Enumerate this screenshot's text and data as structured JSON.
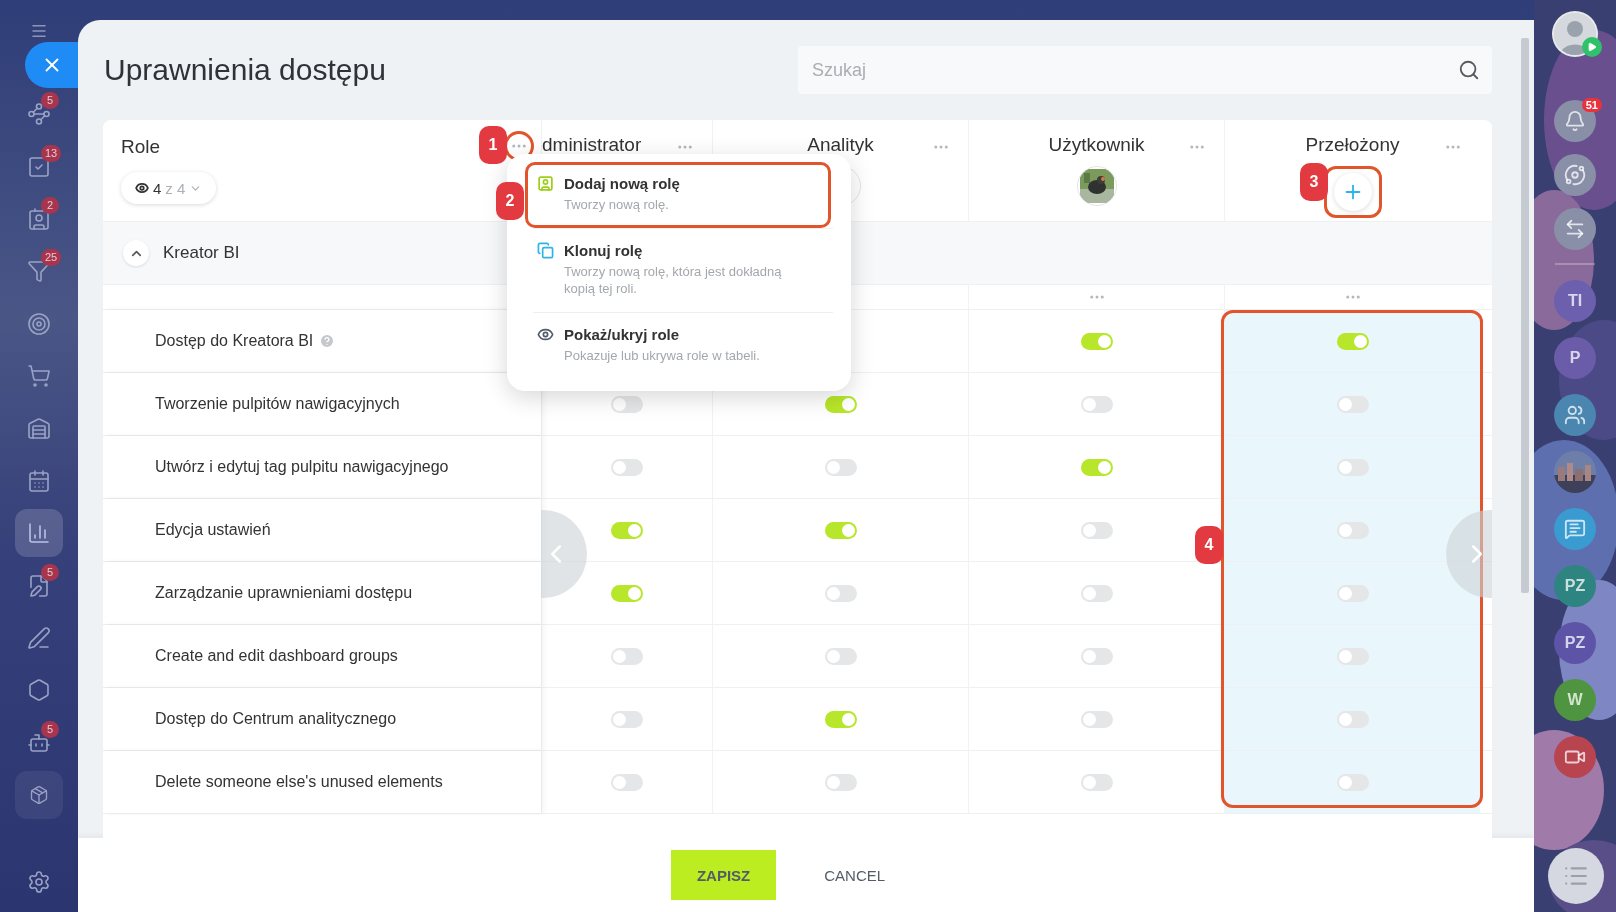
{
  "nav": {
    "items": [
      {
        "badge": "5",
        "selected": false
      },
      {
        "badge": "13",
        "selected": false
      },
      {
        "badge": "2",
        "selected": false
      },
      {
        "badge": "25",
        "selected": false
      },
      {
        "selected": false
      },
      {
        "selected": false
      },
      {
        "selected": false
      },
      {
        "selected": false
      },
      {
        "selected": true
      },
      {
        "badge": "5",
        "selected": false
      },
      {
        "selected": false
      },
      {
        "selected": false
      },
      {
        "badge": "5",
        "selected": false
      }
    ]
  },
  "dialog": {
    "title": "Uprawnienia dostępu",
    "search": {
      "placeholder": "Szukaj"
    }
  },
  "table": {
    "roles_header": {
      "label": "Role",
      "shown": "4",
      "total": "z 4"
    },
    "columns": [
      {
        "title": "dministrator",
        "kind": "plain"
      },
      {
        "title": "Analityk",
        "kind": "blank"
      },
      {
        "title": "Użytkownik"
      },
      {
        "title": "Przełożony",
        "kind": "add",
        "highlighted": true
      }
    ],
    "group": {
      "label": "Kreator BI",
      "expanded": true
    },
    "rows": [
      {
        "label": "Dostęp do Kreatora BI",
        "help": true,
        "cells": [
          {},
          {},
          {
            "on": true
          },
          {
            "on": true
          }
        ]
      },
      {
        "label": "Tworzenie pulpitów nawigacyjnych",
        "help": false,
        "cells": [
          {
            "on": false
          },
          {
            "on": true
          },
          {
            "on": false
          },
          {
            "on": false
          }
        ]
      },
      {
        "label": "Utwórz i edytuj tag pulpitu nawigacyjnego",
        "help": false,
        "cells": [
          {
            "on": false
          },
          {
            "on": false
          },
          {
            "on": true
          },
          {
            "on": false
          }
        ]
      },
      {
        "label": "Edycja ustawień",
        "help": false,
        "cells": [
          {
            "on": true
          },
          {
            "on": true
          },
          {
            "on": false
          },
          {
            "on": false
          }
        ]
      },
      {
        "label": "Zarządzanie uprawnieniami dostępu",
        "help": false,
        "cells": [
          {
            "on": true
          },
          {
            "on": false
          },
          {
            "on": false
          },
          {
            "on": false
          }
        ]
      },
      {
        "label": "Create and edit dashboard groups",
        "help": false,
        "cells": [
          {
            "on": false
          },
          {
            "on": false
          },
          {
            "on": false
          },
          {
            "on": false
          }
        ]
      },
      {
        "label": "Dostęp do Centrum analitycznego",
        "help": false,
        "cells": [
          {
            "on": false
          },
          {
            "on": true
          },
          {
            "on": false
          },
          {
            "on": false
          }
        ]
      },
      {
        "label": "Delete someone else's unused elements",
        "help": false,
        "cells": [
          {
            "on": false
          },
          {
            "on": false
          },
          {
            "on": false
          },
          {
            "on": false
          }
        ]
      }
    ]
  },
  "popup": {
    "items": [
      {
        "title": "Dodaj nową rolę",
        "description": "Tworzy nową rolę.",
        "highlighted": true
      },
      {
        "title": "Klonuj rolę",
        "description": "Tworzy nową rolę, która jest dokładną kopią tej roli.",
        "highlighted": false
      },
      {
        "title": "Pokaż/ukryj role",
        "description": "Pokazuje lub ukrywa role w tabeli.",
        "highlighted": false
      }
    ]
  },
  "annotations": [
    {
      "label": "1"
    },
    {
      "label": "2"
    },
    {
      "label": "3"
    },
    {
      "label": "4"
    }
  ],
  "footer": {
    "buttons": [
      {
        "label": "ZAPISZ",
        "kind": "primary"
      },
      {
        "label": "CANCEL",
        "kind": "link"
      }
    ]
  },
  "right_bar": {
    "items": [
      {
        "kind": "avatar"
      },
      {
        "kind": "icon",
        "badge": "51",
        "color": "#8a8fa8"
      },
      {
        "kind": "icon",
        "color": "#8a8fa8"
      },
      {
        "kind": "icon",
        "color": "#8a8fa8"
      },
      {
        "kind": "divider"
      },
      {
        "kind": "initials",
        "text": "TI",
        "color": "#6c5fae"
      },
      {
        "kind": "initials",
        "text": "P",
        "color": "#6a5ca8"
      },
      {
        "kind": "icon",
        "color": "#4a86b0"
      },
      {
        "kind": "picture"
      },
      {
        "kind": "icon",
        "color": "#3a9bd0"
      },
      {
        "kind": "initials",
        "text": "PZ",
        "color": "#2e8480"
      },
      {
        "kind": "initials",
        "text": "PZ",
        "color": "#5d54a8"
      },
      {
        "kind": "initials",
        "text": "W",
        "color": "#4f9440"
      },
      {
        "kind": "icon",
        "color": "#b84450"
      }
    ]
  }
}
